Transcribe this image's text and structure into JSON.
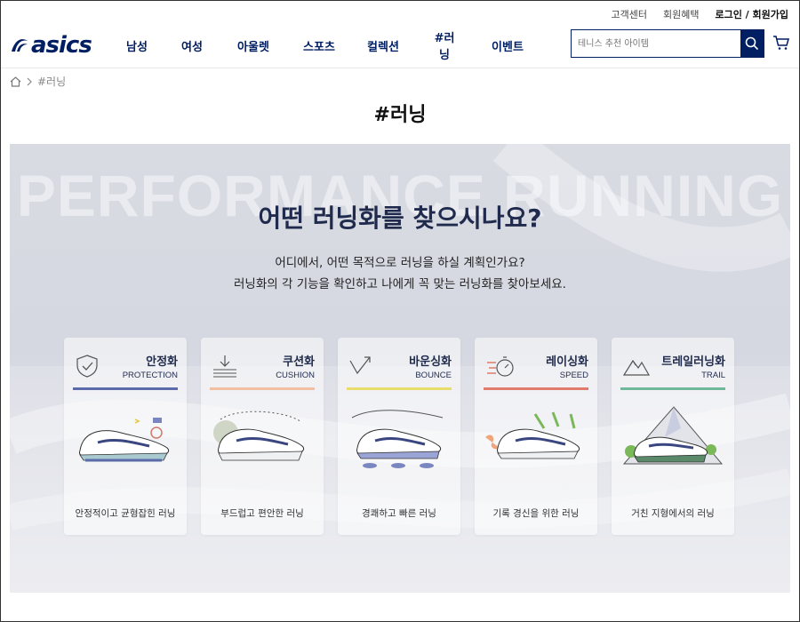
{
  "util": {
    "customer_center": "고객센터",
    "membership": "회원혜택",
    "login_join": "로그인 / 회원가입"
  },
  "brand": {
    "name": "asics",
    "color": "#001e62"
  },
  "nav": {
    "items": [
      "남성",
      "여성",
      "아울렛",
      "스포츠",
      "컬렉션",
      "#러닝",
      "이벤트"
    ]
  },
  "search": {
    "placeholder": "테니스 추천 아이템"
  },
  "breadcrumb": {
    "current": "#러닝"
  },
  "page": {
    "title": "#러닝"
  },
  "hero": {
    "bg_text": "PERFORMANCE RUNNING",
    "heading": "어떤 러닝화를 찾으시나요?",
    "sub_line1": "어디에서, 어떤 목적으로 러닝을 하실 계획인가요?",
    "sub_line2": "러닝화의 각 기능을 확인하고 나에게 꼭 맞는 러닝화를 찾아보세요."
  },
  "cards": [
    {
      "name": "안정화",
      "en": "PROTECTION",
      "desc": "안정적이고 균형잡힌 러닝",
      "color": "#5b6aa8",
      "icon": "shield-check-icon"
    },
    {
      "name": "쿠션화",
      "en": "CUSHION",
      "desc": "부드럽고 편안한 러닝",
      "color": "#f2bfa0",
      "icon": "cushion-arrow-icon"
    },
    {
      "name": "바운싱화",
      "en": "BOUNCE",
      "desc": "경쾌하고 빠른 러닝",
      "color": "#e9dd6a",
      "icon": "bounce-arrow-icon"
    },
    {
      "name": "레이싱화",
      "en": "SPEED",
      "desc": "기록 경신을 위한 러닝",
      "color": "#e07a6a",
      "icon": "stopwatch-icon"
    },
    {
      "name": "트레일러닝화",
      "en": "TRAIL",
      "desc": "거친 지형에서의 러닝",
      "color": "#6fb89a",
      "icon": "mountain-icon"
    }
  ]
}
